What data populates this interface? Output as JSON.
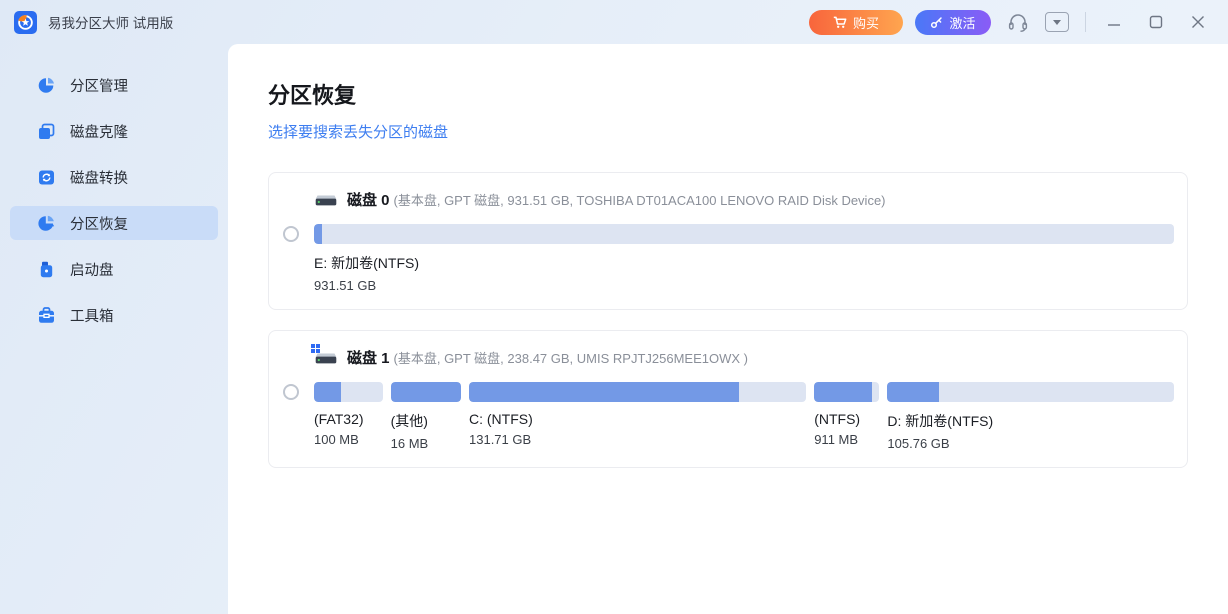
{
  "colors": {
    "accent": "#3e7ef0",
    "bar_fill": "#7399e6",
    "bar_bg": "#dde4f2",
    "buy_grad_start": "#f8653c",
    "buy_grad_end": "#ffa54f",
    "activate_grad_start": "#4a78f7",
    "activate_grad_end": "#8a5cf6",
    "active_item_bg": "#c9dcf8",
    "logo_blue": "#2a6cf0",
    "logo_orange": "#f58220"
  },
  "titlebar": {
    "app_title": "易我分区大师 试用版",
    "buy_label": "购买",
    "activate_label": "激活",
    "icons": [
      "cart-icon",
      "key-icon",
      "headset-icon",
      "chevron-down-icon",
      "minimize-icon",
      "maximize-icon",
      "close-icon"
    ]
  },
  "sidebar": {
    "items": [
      {
        "label": "分区管理",
        "icon": "pie-chart-icon",
        "active": false
      },
      {
        "label": "磁盘克隆",
        "icon": "clone-icon",
        "active": false
      },
      {
        "label": "磁盘转换",
        "icon": "convert-icon",
        "active": false
      },
      {
        "label": "分区恢复",
        "icon": "recovery-icon",
        "active": true
      },
      {
        "label": "启动盘",
        "icon": "boot-disk-icon",
        "active": false
      },
      {
        "label": "工具箱",
        "icon": "toolbox-icon",
        "active": false
      }
    ]
  },
  "page": {
    "title": "分区恢复",
    "subtitle": "选择要搜索丢失分区的磁盘"
  },
  "disks": [
    {
      "name": "磁盘 0",
      "info": "(基本盘, GPT 磁盘, 931.51 GB, TOSHIBA DT01ACA100 LENOVO RAID Disk Device)",
      "system_disk": false,
      "selected": false,
      "partitions": [
        {
          "label": "E: 新加卷(NTFS)",
          "size": "931.51 GB",
          "width_pct": 100,
          "used_pct": 0.9
        }
      ]
    },
    {
      "name": "磁盘 1",
      "info": "(基本盘, GPT 磁盘, 238.47 GB, UMIS RPJTJ256MEE1OWX )",
      "system_disk": true,
      "selected": false,
      "partitions": [
        {
          "label": "(FAT32)",
          "size": "100 MB",
          "width_pct": 8.0,
          "used_pct": 40
        },
        {
          "label": "(其他)",
          "size": "16 MB",
          "width_pct": 8.2,
          "used_pct": 100
        },
        {
          "label": "C: (NTFS)",
          "size": "131.71 GB",
          "width_pct": 39.3,
          "used_pct": 80
        },
        {
          "label": "(NTFS)",
          "size": "911 MB",
          "width_pct": 7.6,
          "used_pct": 88
        },
        {
          "label": "D: 新加卷(NTFS)",
          "size": "105.76 GB",
          "width_pct": 33.4,
          "used_pct": 18
        }
      ]
    }
  ]
}
